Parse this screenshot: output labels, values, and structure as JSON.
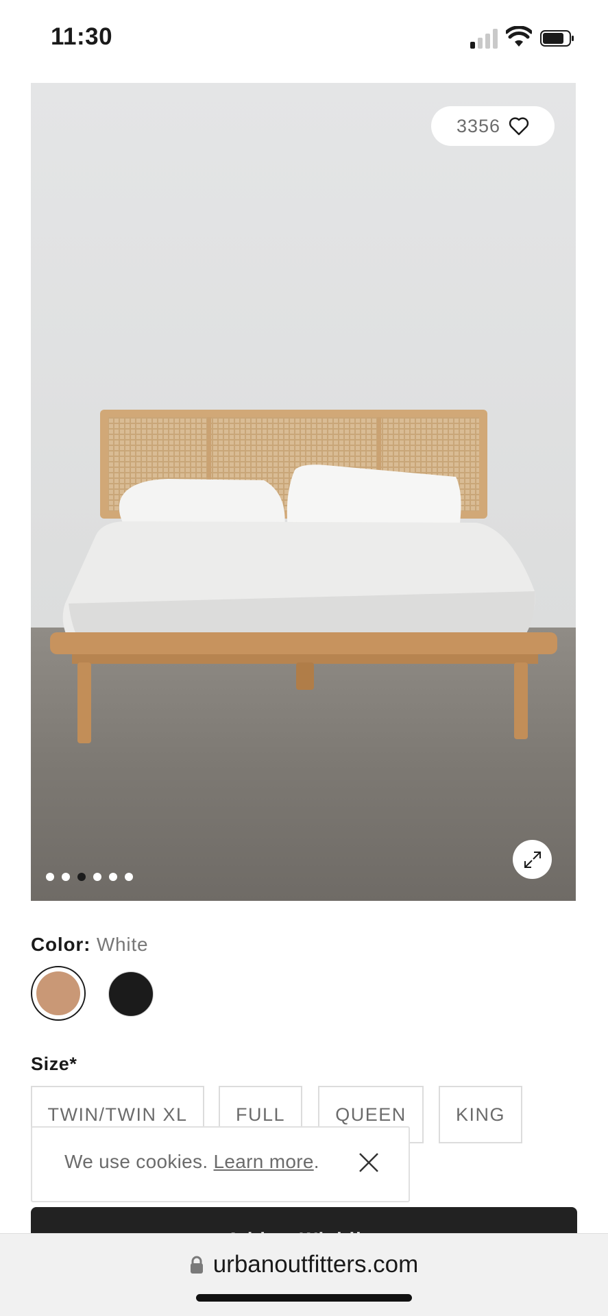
{
  "status_bar": {
    "time": "11:30",
    "signal_icon": "signal-icon",
    "wifi_icon": "wifi-icon",
    "battery_icon": "battery-icon"
  },
  "product_image": {
    "favorites_count": "3356",
    "favorite_icon": "heart-icon",
    "expand_icon": "expand-icon",
    "carousel_total": 6,
    "carousel_active_index": 2
  },
  "color_picker": {
    "label": "Color:",
    "selected_value": "White",
    "swatches": [
      {
        "name": "tan",
        "color": "#c99876",
        "selected": true
      },
      {
        "name": "black",
        "color": "#1b1b1b",
        "selected": false
      }
    ]
  },
  "size_picker": {
    "label": "Size*",
    "options": [
      "TWIN/TWIN XL",
      "FULL",
      "QUEEN",
      "KING"
    ]
  },
  "cookie_banner": {
    "text": "We use cookies.",
    "link": "Learn more",
    "suffix": ".",
    "close_icon": "close-icon"
  },
  "add_to_cart": {
    "label": "Add to Wishlist"
  },
  "browser": {
    "url": "urbanoutfitters.com",
    "lock_icon": "lock-icon"
  }
}
